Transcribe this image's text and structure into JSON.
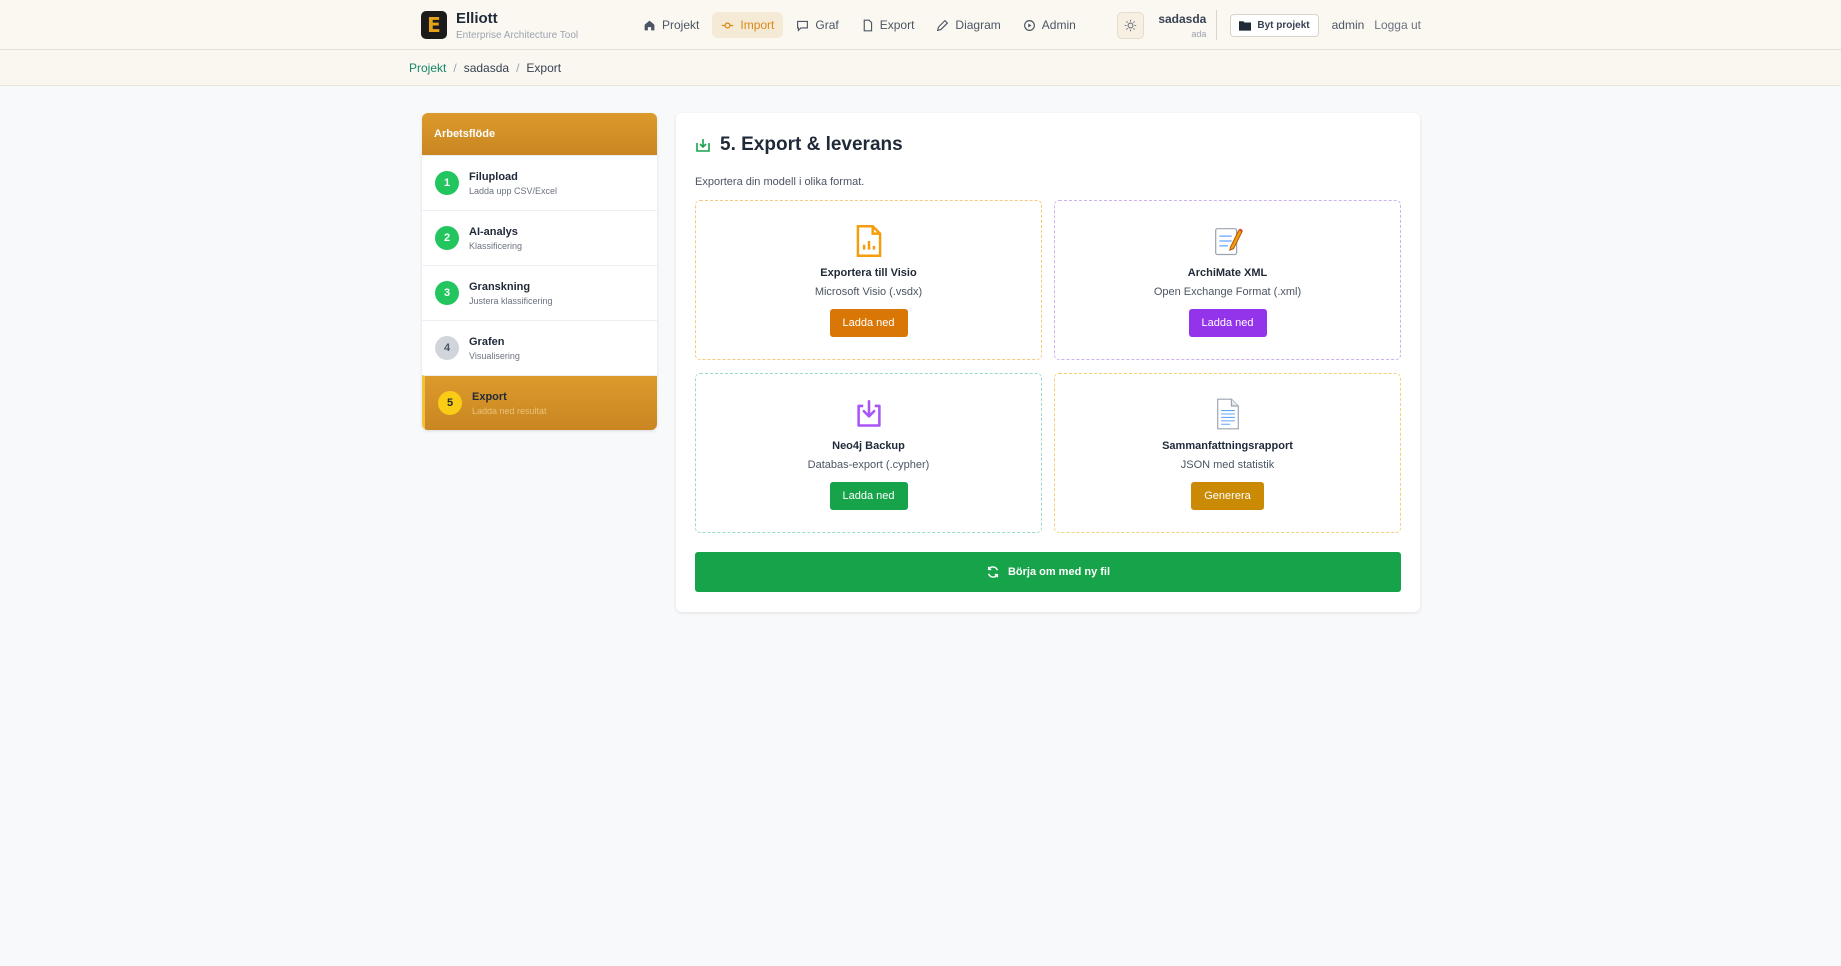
{
  "header": {
    "brand_letter": "E",
    "brand_title": "Elliott",
    "brand_subtitle": "Enterprise Architecture Tool",
    "nav": [
      {
        "label": "Projekt",
        "icon": "home-icon"
      },
      {
        "label": "Import",
        "icon": "git-commit-icon",
        "active": true
      },
      {
        "label": "Graf",
        "icon": "chat-icon"
      },
      {
        "label": "Export",
        "icon": "file-icon"
      },
      {
        "label": "Diagram",
        "icon": "pencil-icon"
      },
      {
        "label": "Admin",
        "icon": "play-circle-icon"
      }
    ],
    "project_name": "sadasda",
    "project_sub": "ada",
    "switch_label": "Byt projekt",
    "user": "admin",
    "logout": "Logga ut"
  },
  "breadcrumb": {
    "root": "Projekt",
    "project": "sadasda",
    "current": "Export",
    "separator": "/"
  },
  "sidebar": {
    "title": "Arbetsflöde",
    "steps": [
      {
        "num": "1",
        "title": "Filupload",
        "sub": "Ladda upp CSV/Excel"
      },
      {
        "num": "2",
        "title": "AI-analys",
        "sub": "Klassificering"
      },
      {
        "num": "3",
        "title": "Granskning",
        "sub": "Justera klassificering"
      },
      {
        "num": "4",
        "title": "Grafen",
        "sub": "Visualisering"
      },
      {
        "num": "5",
        "title": "Export",
        "sub": "Ladda ned resultat"
      }
    ]
  },
  "main": {
    "title": "5. Export & leverans",
    "description": "Exportera din modell i olika format.",
    "cards": [
      {
        "title": "Exportera till Visio",
        "sub": "Microsoft Visio (.vsdx)",
        "button": "Ladda ned",
        "icon": "document-chart-icon"
      },
      {
        "title": "ArchiMate XML",
        "sub": "Open Exchange Format (.xml)",
        "button": "Ladda ned",
        "icon": "memo-icon"
      },
      {
        "title": "Neo4j Backup",
        "sub": "Databas-export (.cypher)",
        "button": "Ladda ned",
        "icon": "download-tray-icon"
      },
      {
        "title": "Sammanfattningsrapport",
        "sub": "JSON med statistik",
        "button": "Generera",
        "icon": "page-icon"
      }
    ],
    "restart_label": "Börja om med ny fil"
  },
  "colors": {
    "accent": "#d98a17",
    "green": "#16a34a",
    "purple": "#9333ea",
    "orange": "#d97706",
    "gold": "#ca8a04"
  }
}
